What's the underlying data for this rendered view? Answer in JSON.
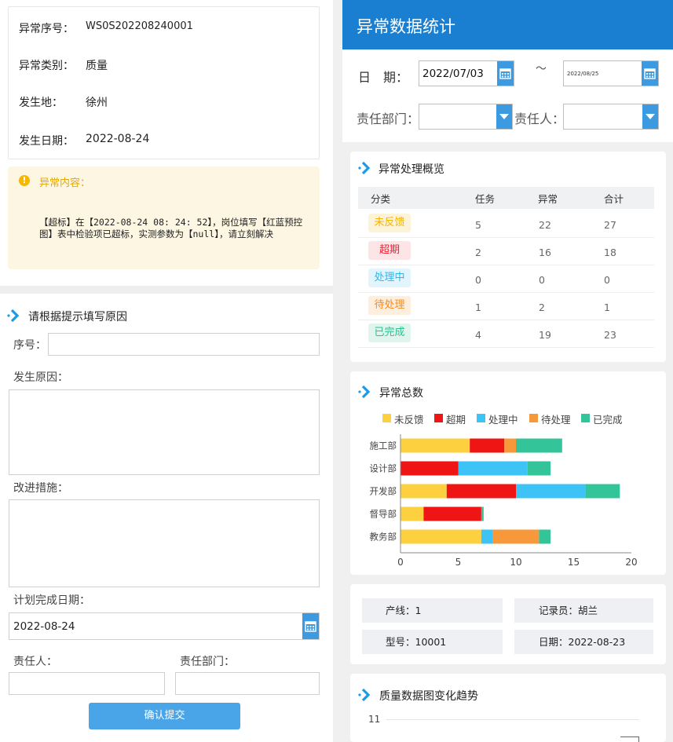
{
  "form": {
    "info": [
      {
        "label": "异常序号：",
        "value": "WS0S202208240001"
      },
      {
        "label": "异常类别：",
        "value": "质量"
      },
      {
        "label": "发生地：",
        "value": "徐州"
      },
      {
        "label": "发生日期：",
        "value": "2022-08-24"
      }
    ],
    "alert_title": "异常内容：",
    "alert_text": "【超标】在【2022-08-24 08: 24: 52】，岗位填写【红蓝预控图】表中检验项已超标，实测参数为【null】，请立刻解决",
    "section_title": "请根据提示填写原因",
    "seq_label": "序号：",
    "cause_label": "发生原因：",
    "measure_label": "改进措施：",
    "plan_label": "计划完成日期：",
    "plan_value": "2022-08-24",
    "person_label": "责任人：",
    "dept_label": "责任部门：",
    "submit_label": "确认提交"
  },
  "stats": {
    "header": "异常数据统计",
    "filter": {
      "date_label": "日　期：",
      "date_from": "2022/07/03",
      "date_sep": "～",
      "date_to": "2022/08/25",
      "dept_label": "责任部门：",
      "person_label": "责任人："
    },
    "overview": {
      "title": "异常处理概览",
      "columns": [
        "分类",
        "任务",
        "异常",
        "合计"
      ],
      "rows": [
        {
          "name": "未反馈",
          "task": "5",
          "abnormal": "22",
          "total": "27",
          "color": "#f2b400",
          "bg": "#fdf3d8"
        },
        {
          "name": "超期",
          "task": "2",
          "abnormal": "16",
          "total": "18",
          "color": "#ee2233",
          "bg": "#fde5e7"
        },
        {
          "name": "处理中",
          "task": "0",
          "abnormal": "0",
          "total": "0",
          "color": "#2eb6ee",
          "bg": "#e2f5fd"
        },
        {
          "name": "待处理",
          "task": "1",
          "abnormal": "2",
          "total": "1",
          "color": "#f58a1f",
          "bg": "#fdeedd"
        },
        {
          "name": "已完成",
          "task": "4",
          "abnormal": "19",
          "total": "23",
          "color": "#2dbf8f",
          "bg": "#e0f5ee"
        }
      ]
    },
    "total_title": "异常总数",
    "chart_data": {
      "type": "bar",
      "orientation": "horizontal",
      "stacked": true,
      "categories": [
        "施工部",
        "设计部",
        "开发部",
        "督导部",
        "教务部"
      ],
      "series": [
        {
          "name": "未反馈",
          "color": "#fcd03f",
          "values": [
            6,
            0,
            4,
            2,
            7
          ]
        },
        {
          "name": "超期",
          "color": "#f01515",
          "values": [
            3,
            5,
            6,
            5,
            0
          ]
        },
        {
          "name": "处理中",
          "color": "#3dc3f5",
          "values": [
            0,
            6,
            6,
            0,
            1
          ]
        },
        {
          "name": "待处理",
          "color": "#f7983a",
          "values": [
            1,
            0,
            0,
            0,
            4
          ]
        },
        {
          "name": "已完成",
          "color": "#34c49a",
          "values": [
            4,
            2,
            3,
            0.2,
            1
          ]
        }
      ],
      "xlim": [
        0,
        20
      ],
      "xticks": [
        "0",
        "5",
        "10",
        "15",
        "20"
      ]
    },
    "meta": {
      "line": "产线：1",
      "recorder": "记录员：胡兰",
      "model": "型号：10001",
      "date": "日期：2022-08-23"
    },
    "trend": {
      "title": "质量数据图变化趋势",
      "tick": "11"
    }
  }
}
